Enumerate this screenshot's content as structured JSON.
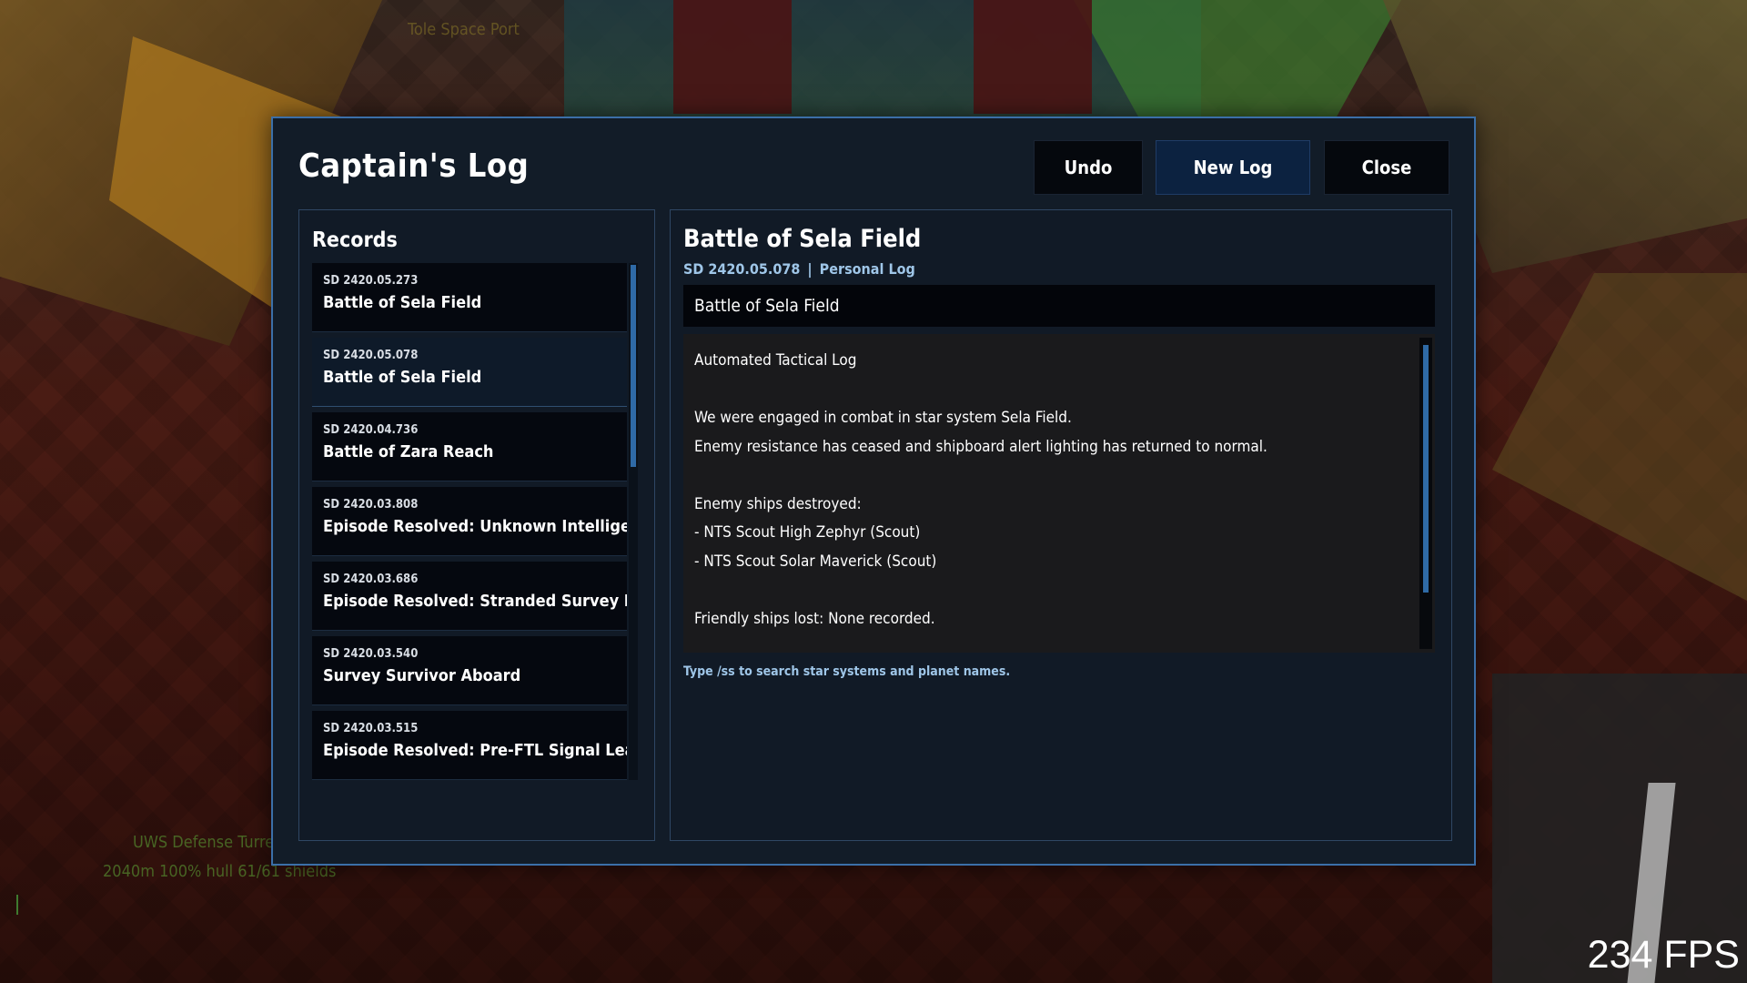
{
  "hud": {
    "location": "Tole Space Port",
    "target_name": "UWS Defense Turret",
    "target_stats": "2040m  100% hull  61/61 shields",
    "fps": "234 FPS"
  },
  "dialog": {
    "title": "Captain's Log",
    "buttons": {
      "undo": "Undo",
      "new_log": "New Log",
      "close": "Close"
    }
  },
  "records": {
    "heading": "Records",
    "scroll_position": 0.0,
    "items": [
      {
        "date": "SD 2420.05.273",
        "title": "Battle of Sela Field",
        "selected": false
      },
      {
        "date": "SD 2420.05.078",
        "title": "Battle of Sela Field",
        "selected": true
      },
      {
        "date": "SD 2420.04.736",
        "title": "Battle of Zara Reach",
        "selected": false
      },
      {
        "date": "SD 2420.03.808",
        "title": "Episode Resolved: Unknown Intelligent Sig",
        "selected": false
      },
      {
        "date": "SD 2420.03.686",
        "title": "Episode Resolved: Stranded Survey Exped",
        "selected": false
      },
      {
        "date": "SD 2420.03.540",
        "title": "Survey Survivor Aboard",
        "selected": false
      },
      {
        "date": "SD 2420.03.515",
        "title": "Episode Resolved: Pre-FTL Signal Leakage",
        "selected": false
      }
    ]
  },
  "detail": {
    "title": "Battle of Sela Field",
    "stardate": "SD 2420.05.078",
    "separator": "|",
    "log_type": "Personal Log",
    "title_field_value": "Battle of Sela Field",
    "body_lines": [
      "Automated Tactical Log",
      "",
      "We were engaged in combat in star system Sela Field.",
      "Enemy resistance has ceased and shipboard alert lighting has returned to normal.",
      "",
      "Enemy ships destroyed:",
      "- NTS Scout High Zephyr (Scout)",
      "- NTS Scout Solar Maverick (Scout)",
      "",
      "Friendly ships lost: None recorded."
    ],
    "hint": "Type /ss to search star systems and planet names."
  },
  "colors": {
    "panel_border": "#3b6fa8",
    "accent_text": "#9fc6e8",
    "scrollbar": "#2f6aa6",
    "selected_button": "#0c2240"
  }
}
